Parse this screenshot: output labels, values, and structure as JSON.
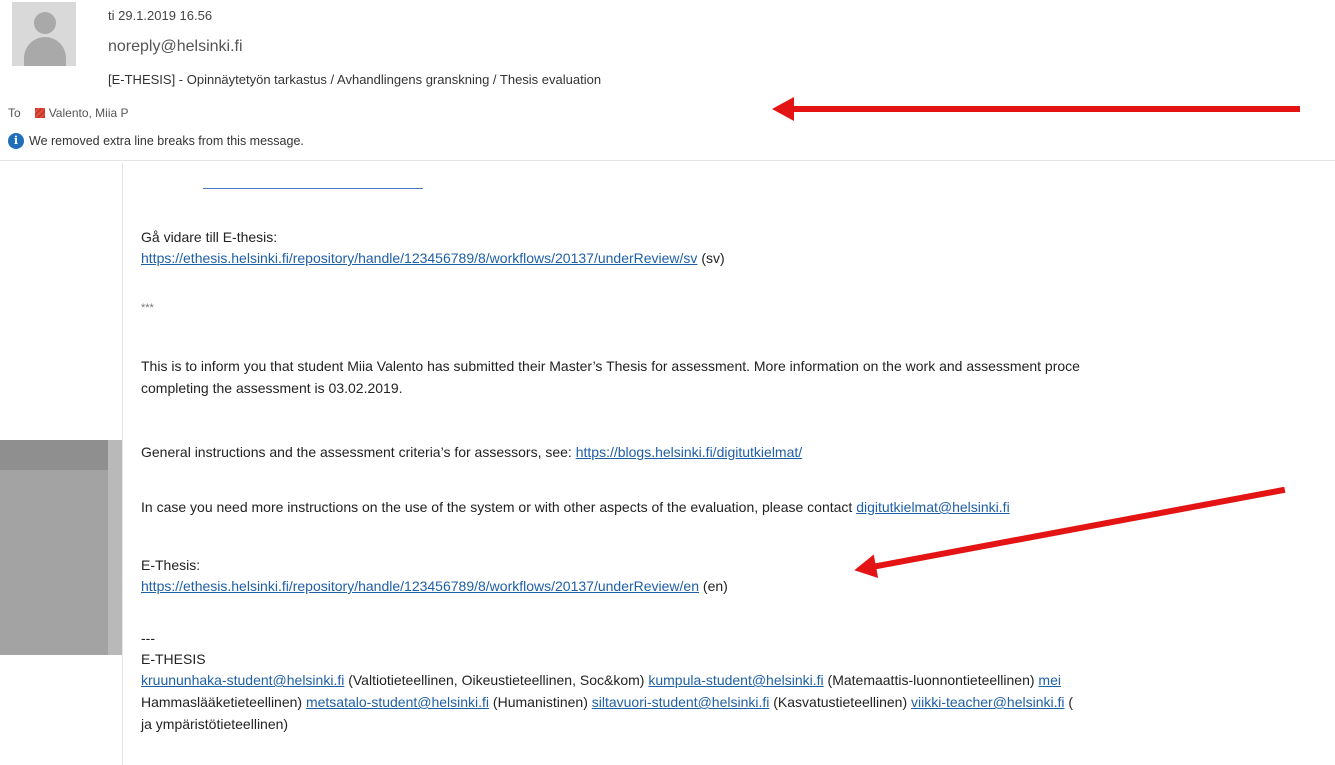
{
  "header": {
    "date": "ti 29.1.2019 16.56",
    "from": "noreply@helsinki.fi",
    "subject": "[E-THESIS] - Opinnäytetyön tarkastus / Avhandlingens granskning / Thesis evaluation",
    "to_label": "To",
    "recipient": "Valento, Miia P",
    "info_notice": "We removed extra line breaks from this message.",
    "icons": {
      "avatar": "person-avatar-icon",
      "info": "info-icon",
      "recipient": "contact-icon"
    }
  },
  "body": {
    "sv_intro": "Gå vidare till E-thesis:",
    "sv_link": "https://ethesis.helsinki.fi/repository/handle/123456789/8/workflows/20137/underReview/sv",
    "sv_suffix": " (sv)",
    "separator": "***",
    "inform_line1": "This is to inform you that student Miia Valento has submitted their Master’s Thesis for assessment. More information on the work and assessment proce",
    "inform_line2": "completing the assessment is 03.02.2019.",
    "general_prefix": "General instructions and the assessment criteria’s for assessors, see: ",
    "general_link": "https://blogs.helsinki.fi/digitutkielmat/",
    "contact_prefix": "In case you need more instructions on the use of the system or with other aspects of the evaluation, please contact ",
    "contact_link": "digitutkielmat@helsinki.fi",
    "en_intro": "E-Thesis:",
    "en_link": "https://ethesis.helsinki.fi/repository/handle/123456789/8/workflows/20137/underReview/en",
    "en_suffix": " (en)",
    "dashes": "---",
    "sig_title": "E-THESIS",
    "sig_line1": [
      {
        "email": "kruununhaka-student@helsinki.fi",
        "desc": " (Valtiotieteellinen, Oikeustieteellinen, Soc&kom) "
      },
      {
        "email": "kumpula-student@helsinki.fi",
        "desc": " (Matemaattis-luonnontieteellinen) "
      },
      {
        "email": "mei",
        "desc": ""
      }
    ],
    "sig_line2_start": "Hammaslääketieteellinen) ",
    "sig_line2": [
      {
        "email": "metsatalo-student@helsinki.fi",
        "desc": " (Humanistinen) "
      },
      {
        "email": "siltavuori-student@helsinki.fi",
        "desc": " (Kasvatustieteellinen) "
      },
      {
        "email": "viikki-teacher@helsinki.fi",
        "desc": " ("
      }
    ],
    "sig_line3": "ja ympäristötieteellinen)"
  },
  "colors": {
    "link": "#1f5fa6",
    "arrow": "#e41414",
    "info": "#1e6fb8"
  }
}
